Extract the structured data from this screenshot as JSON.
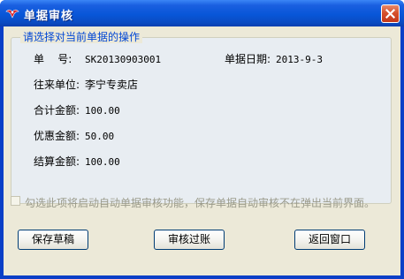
{
  "window": {
    "title": "单据审核"
  },
  "group": {
    "legend": "请选择对当前单据的操作"
  },
  "fields": {
    "doc_no_label": "单    号:",
    "doc_no_value": "SK20130903001",
    "doc_date_label": "单据日期:",
    "doc_date_value": "2013-9-3",
    "partner_label": "往来单位:",
    "partner_value": "李宁专卖店",
    "total_label": "合计金额:",
    "total_value": "100.00",
    "discount_label": "优惠金额:",
    "discount_value": "50.00",
    "settle_label": "结算金额:",
    "settle_value": "100.00"
  },
  "auto_audit": {
    "label": "勾选此项将启动自动单据审核功能，保存单据自动审核不在弹出当前界面。",
    "checked": false
  },
  "buttons": {
    "save_draft": "保存草稿",
    "audit_post": "审核过账",
    "back": "返回窗口"
  },
  "icons": {
    "app": "bird-logo-icon",
    "close": "close-icon"
  }
}
